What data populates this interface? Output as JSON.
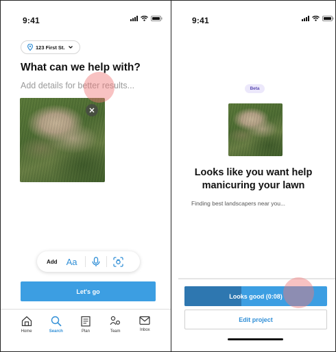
{
  "colors": {
    "accent": "#3c9ee2",
    "accent_dark": "#2e77b0",
    "beta_bg": "#ece8fb",
    "beta_text": "#5b4cb2"
  },
  "left_screen": {
    "status_time": "9:41",
    "address_pill": {
      "icon": "location-pin-icon",
      "label": "123 First St.",
      "chevron": "chevron-down-icon"
    },
    "headline": "What can we help with?",
    "details_placeholder": "Add details for better results...",
    "photo": {
      "remove_icon": "close-icon"
    },
    "toolbar": {
      "add_label": "Add",
      "text_label": "Aa",
      "icons": [
        "microphone-icon",
        "camera-scan-icon"
      ]
    },
    "primary_button": "Let's go",
    "tabs": [
      {
        "label": "Home",
        "icon": "home-icon",
        "active": false
      },
      {
        "label": "Search",
        "icon": "search-icon",
        "active": true
      },
      {
        "label": "Plan",
        "icon": "plan-icon",
        "active": false
      },
      {
        "label": "Team",
        "icon": "team-icon",
        "active": false
      },
      {
        "label": "Inbox",
        "icon": "inbox-icon",
        "active": false
      }
    ]
  },
  "right_screen": {
    "status_time": "9:41",
    "badge": "Beta",
    "title": "Looks like you want help manicuring your lawn",
    "subtitle": "Finding best landscapers near you...",
    "confirm_button": "Looks good (0:08)",
    "confirm_progress": 0.4,
    "edit_button": "Edit project"
  }
}
